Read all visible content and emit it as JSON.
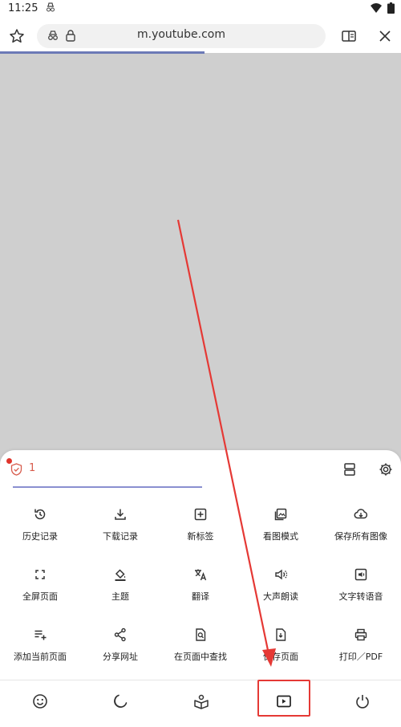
{
  "status_bar": {
    "time": "11:25"
  },
  "toolbar": {
    "url": "m.youtube.com",
    "page_load_progress": 0.51
  },
  "menu": {
    "shield_count": "1",
    "items": [
      {
        "label": "历史记录",
        "icon": "history-icon"
      },
      {
        "label": "下载记录",
        "icon": "download-icon"
      },
      {
        "label": "新标签",
        "icon": "new-tab-icon"
      },
      {
        "label": "看图模式",
        "icon": "image-mode-icon"
      },
      {
        "label": "保存所有图像",
        "icon": "save-images-icon"
      },
      {
        "label": "全屏页面",
        "icon": "fullscreen-icon"
      },
      {
        "label": "主题",
        "icon": "theme-icon"
      },
      {
        "label": "翻译",
        "icon": "translate-icon"
      },
      {
        "label": "大声朗读",
        "icon": "read-aloud-icon"
      },
      {
        "label": "文字转语音",
        "icon": "text-to-speech-icon"
      },
      {
        "label": "添加当前页面",
        "icon": "add-page-icon"
      },
      {
        "label": "分享网址",
        "icon": "share-icon"
      },
      {
        "label": "在页面中查找",
        "icon": "find-in-page-icon"
      },
      {
        "label": "保存页面",
        "icon": "save-page-icon"
      },
      {
        "label": "打印／PDF",
        "icon": "print-icon"
      }
    ]
  },
  "bottom_nav": [
    {
      "icon": "emoji-icon"
    },
    {
      "icon": "night-mode-icon"
    },
    {
      "icon": "reader-mode-icon"
    },
    {
      "icon": "video-player-icon",
      "highlighted": true
    },
    {
      "icon": "power-icon"
    }
  ],
  "colors": {
    "accent": "#8a8fd0",
    "annotation": "#e53935",
    "shield": "#d75b4c"
  }
}
